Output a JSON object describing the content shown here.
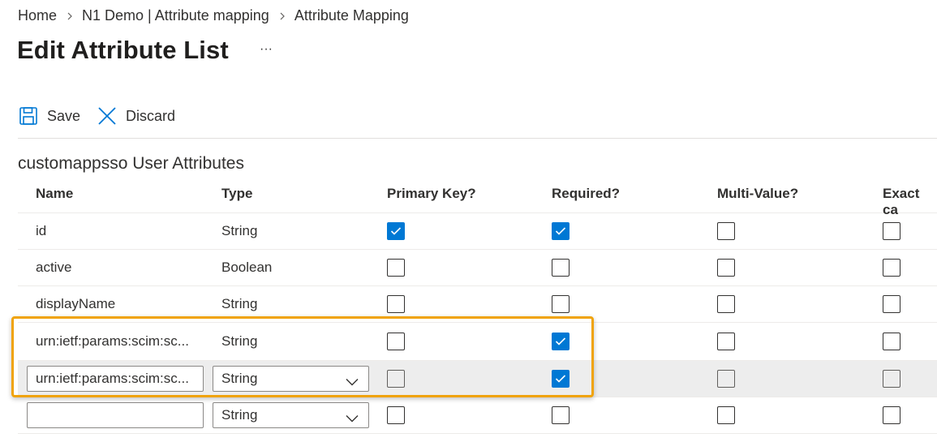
{
  "breadcrumb": {
    "items": [
      "Home",
      "N1 Demo | Attribute mapping",
      "Attribute Mapping"
    ]
  },
  "page": {
    "title": "Edit Attribute List",
    "more_label": "···"
  },
  "toolbar": {
    "save_label": "Save",
    "discard_label": "Discard"
  },
  "section": {
    "title": "customappsso User Attributes"
  },
  "table": {
    "headers": {
      "name": "Name",
      "type": "Type",
      "primary_key": "Primary Key?",
      "required": "Required?",
      "multi_value": "Multi-Value?",
      "exact_case": "Exact ca"
    },
    "rows": [
      {
        "name": "id",
        "type": "String",
        "primary_key": true,
        "required": true,
        "multi_value": false,
        "exact_case": false
      },
      {
        "name": "active",
        "type": "Boolean",
        "primary_key": false,
        "required": false,
        "multi_value": false,
        "exact_case": false
      },
      {
        "name": "displayName",
        "type": "String",
        "primary_key": false,
        "required": false,
        "multi_value": false,
        "exact_case": false
      },
      {
        "name": "urn:ietf:params:scim:sc...",
        "type": "String",
        "primary_key": false,
        "required": true,
        "multi_value": false,
        "exact_case": false
      }
    ],
    "edit_row": {
      "name_value": "urn:ietf:params:scim:sc...",
      "type_value": "String",
      "primary_key": false,
      "required": true,
      "multi_value": false,
      "exact_case": false
    },
    "new_row": {
      "name_value": "",
      "type_value": "String",
      "primary_key": false,
      "required": false,
      "multi_value": false,
      "exact_case": false
    }
  },
  "colors": {
    "accent": "#0078d4",
    "highlight": "#f0a30a",
    "selected_row": "#ededed"
  }
}
